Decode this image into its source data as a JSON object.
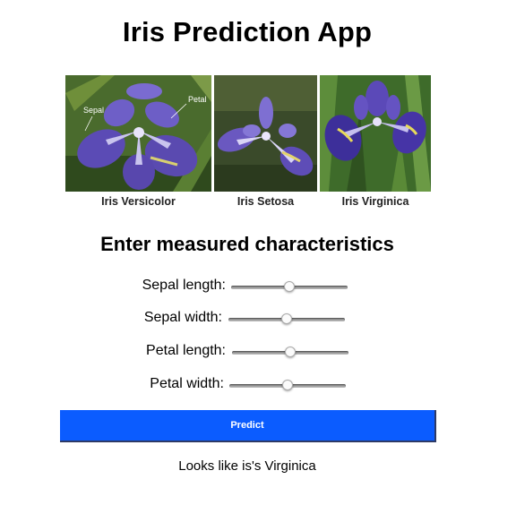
{
  "app": {
    "title": "Iris Prediction App"
  },
  "figure": {
    "annotations": {
      "sepal": "Sepal",
      "petal": "Petal"
    },
    "captions": [
      "Iris Versicolor",
      "Iris Setosa",
      "Iris Virginica"
    ]
  },
  "form": {
    "heading": "Enter measured characteristics",
    "sliders": [
      {
        "label": "Sepal length:",
        "value_fraction": 0.5
      },
      {
        "label": "Sepal width:",
        "value_fraction": 0.5
      },
      {
        "label": "Petal length:",
        "value_fraction": 0.5
      },
      {
        "label": "Petal width:",
        "value_fraction": 0.5
      }
    ],
    "predict_label": "Predict"
  },
  "result": {
    "text": "Looks like is's Virginica"
  },
  "colors": {
    "button": "#0b5cff",
    "petal_purple": "#5b4bb5",
    "foliage": "#3e6b2a"
  }
}
